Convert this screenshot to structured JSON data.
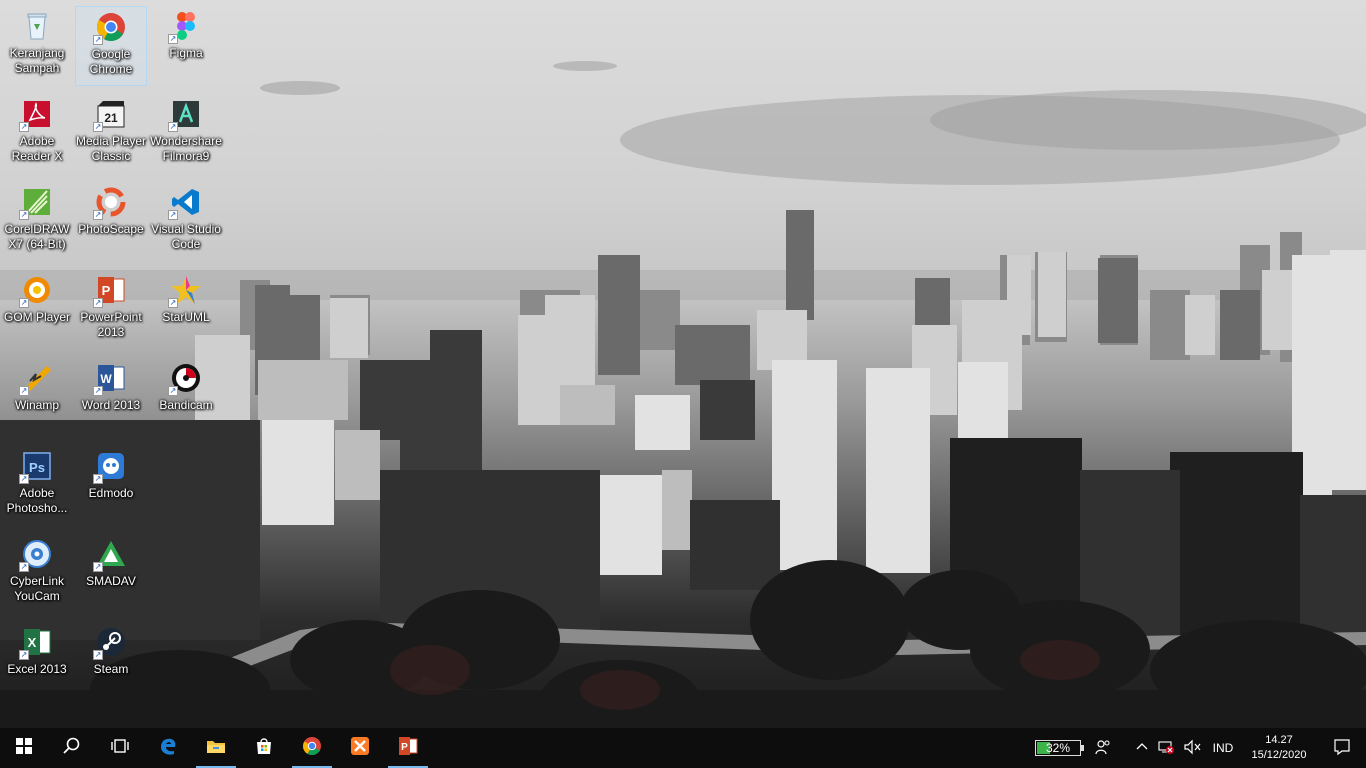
{
  "desktop": {
    "icons": [
      {
        "label": "Keranjang Sampah",
        "icon": "recycle-bin-icon",
        "color": "#cfe6f7"
      },
      {
        "label": "Google Chrome",
        "icon": "chrome-icon",
        "color": "#4285f4"
      },
      {
        "label": "Figma",
        "icon": "figma-icon",
        "color": "#f24e1e"
      },
      {
        "label": "Adobe Reader X",
        "icon": "adobe-reader-icon",
        "color": "#c8102e"
      },
      {
        "label": "Media Player Classic",
        "icon": "media-player-classic-icon",
        "color": "#222222"
      },
      {
        "label": "Wondershare Filmora9",
        "icon": "filmora-icon",
        "color": "#2d3a3a"
      },
      {
        "label": "CorelDRAW X7 (64-Bit)",
        "icon": "coreldraw-icon",
        "color": "#5fae3b"
      },
      {
        "label": "PhotoScape",
        "icon": "photoscape-icon",
        "color": "#e8542c"
      },
      {
        "label": "Visual Studio Code",
        "icon": "vscode-icon",
        "color": "#0a7acc"
      },
      {
        "label": "GOM Player",
        "icon": "gom-player-icon",
        "color": "#f08a00"
      },
      {
        "label": "PowerPoint 2013",
        "icon": "powerpoint-icon",
        "color": "#d24726"
      },
      {
        "label": "StarUML",
        "icon": "staruml-icon",
        "color": "#e53a8e"
      },
      {
        "label": "Winamp",
        "icon": "winamp-icon",
        "color": "#f0a800"
      },
      {
        "label": "Word 2013",
        "icon": "word-icon",
        "color": "#2b579a"
      },
      {
        "label": "Bandicam",
        "icon": "bandicam-icon",
        "color": "#d0021b"
      },
      {
        "label": "Adobe Photosho...",
        "icon": "photoshop-icon",
        "color": "#1a3a6e"
      },
      {
        "label": "Edmodo",
        "icon": "edmodo-icon",
        "color": "#2d7bd6"
      },
      {
        "label": "CyberLink YouCam",
        "icon": "youcam-icon",
        "color": "#3a7fd0"
      },
      {
        "label": "SMADAV",
        "icon": "smadav-icon",
        "color": "#2fa84f"
      },
      {
        "label": "Excel 2013",
        "icon": "excel-icon",
        "color": "#217346"
      },
      {
        "label": "Steam",
        "icon": "steam-icon",
        "color": "#1b2838"
      }
    ]
  },
  "taskbar": {
    "start": "start-icon",
    "search": "search-icon",
    "task_view": "task-view-icon",
    "pinned": [
      {
        "icon": "edge-icon",
        "color": "#1a7fd4",
        "running": false
      },
      {
        "icon": "file-explorer-icon",
        "color": "#f3c33c",
        "running": true
      },
      {
        "icon": "microsoft-store-icon",
        "color": "#ffffff",
        "running": false
      },
      {
        "icon": "chrome-icon",
        "color": "#4285f4",
        "running": true
      },
      {
        "icon": "xampp-icon",
        "color": "#fb7a24",
        "running": false
      },
      {
        "icon": "powerpoint-icon",
        "color": "#d24726",
        "running": true
      }
    ],
    "tray": {
      "battery_percent": "32%",
      "battery_level": 0.32,
      "people_icon": "people-icon",
      "chevron_icon": "chevron-up-icon",
      "network_icon": "network-disconnected-icon",
      "volume_icon": "volume-muted-icon",
      "language": "IND",
      "time": "14.27",
      "date": "15/12/2020",
      "notification_icon": "action-center-icon"
    }
  }
}
